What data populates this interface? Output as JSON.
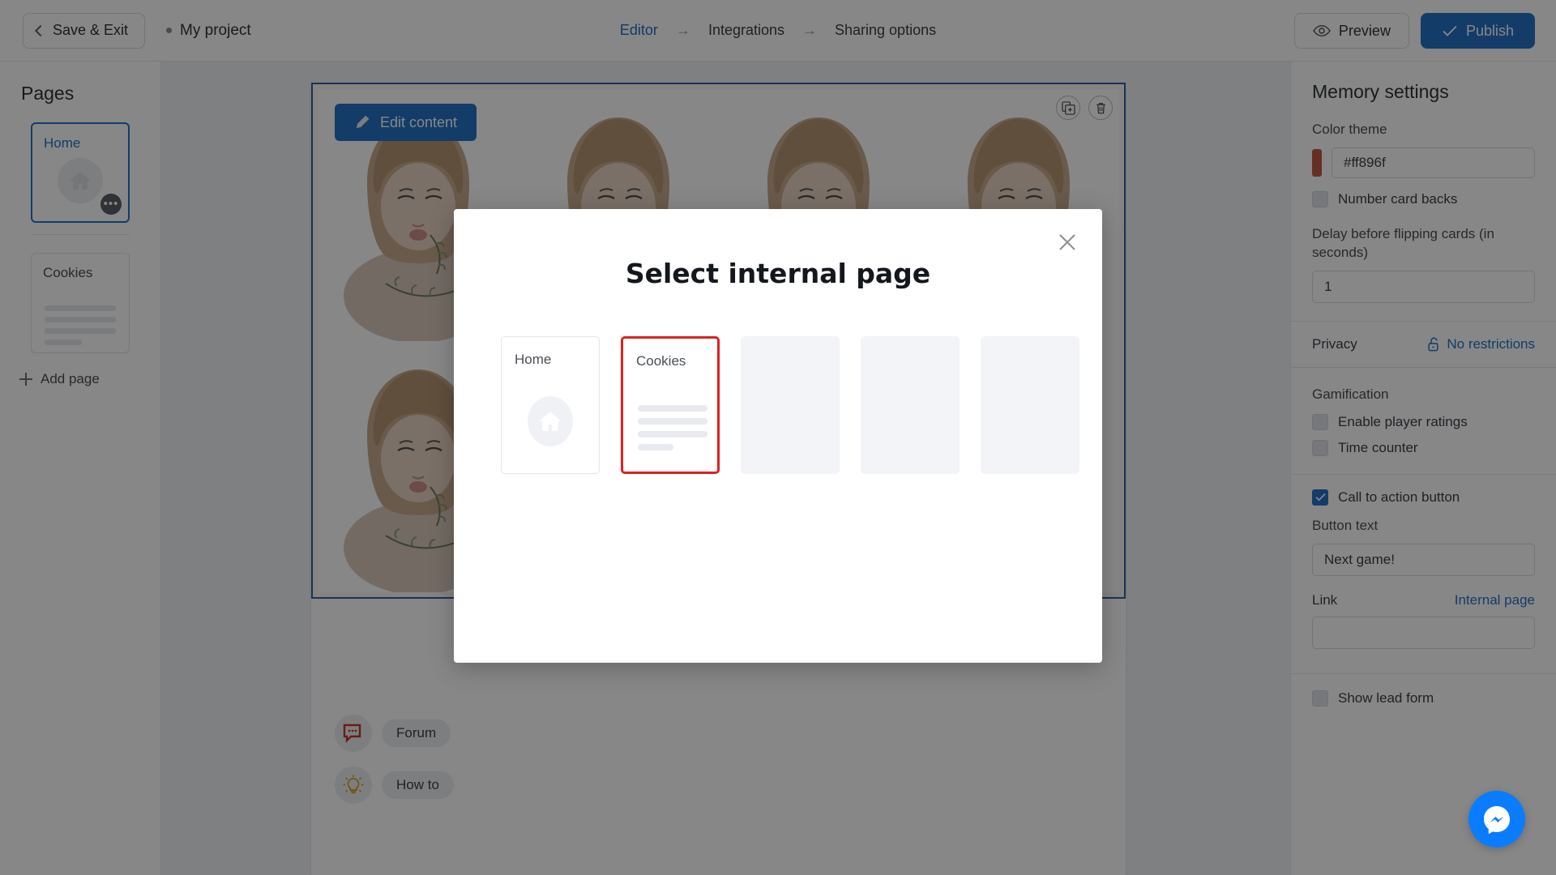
{
  "topbar": {
    "save_exit_label": "Save & Exit",
    "project_name": "My project",
    "breadcrumbs": [
      {
        "label": "Editor",
        "active": true
      },
      {
        "label": "Integrations",
        "active": false
      },
      {
        "label": "Sharing options",
        "active": false
      }
    ],
    "arrow_glyph": "→",
    "preview_label": "Preview",
    "publish_label": "Publish"
  },
  "sidebar": {
    "title": "Pages",
    "pages": [
      {
        "label": "Home",
        "selected": true,
        "thumb": "home-icon"
      },
      {
        "label": "Cookies",
        "selected": false,
        "thumb": "text-lines"
      }
    ],
    "add_page_label": "Add page"
  },
  "canvas": {
    "edit_content_label": "Edit content",
    "tools": [
      {
        "name": "duplicate-icon"
      },
      {
        "name": "delete-icon"
      }
    ],
    "cards_count": 8
  },
  "right_panel": {
    "title": "Memory settings",
    "color_theme_label": "Color theme",
    "color_theme_value": "#ff896f",
    "color_swatch_hex": "#c15a43",
    "number_card_backs_label": "Number card backs",
    "number_card_backs_checked": false,
    "delay_label": "Delay before flipping cards (in seconds)",
    "delay_value": "1",
    "privacy_label": "Privacy",
    "privacy_value": "No restrictions",
    "gamification_label": "Gamification",
    "enable_player_ratings_label": "Enable player ratings",
    "enable_player_ratings_checked": false,
    "time_counter_label": "Time counter",
    "time_counter_checked": false,
    "cta_label": "Call to action button",
    "cta_checked": true,
    "button_text_label": "Button text",
    "button_text_value": "Next game!",
    "link_label": "Link",
    "link_value": "Internal page",
    "link_field_value": "",
    "show_lead_form_label": "Show lead form",
    "show_lead_form_checked": false
  },
  "floaters": {
    "forum_label": "Forum",
    "howto_label": "How to",
    "messenger_name": "messenger-icon"
  },
  "modal": {
    "title": "Select internal page",
    "close_label": "✕",
    "pages": [
      {
        "label": "Home",
        "type": "home",
        "highlighted": false
      },
      {
        "label": "Cookies",
        "type": "lines",
        "highlighted": true
      },
      {
        "label": "",
        "type": "empty",
        "highlighted": false
      },
      {
        "label": "",
        "type": "empty",
        "highlighted": false
      },
      {
        "label": "",
        "type": "empty",
        "highlighted": false
      }
    ]
  },
  "colors": {
    "accent_blue": "#2571c6",
    "highlight_red": "#e02020",
    "messenger_blue": "#0a7cff",
    "panel_border": "#e6e8ec"
  }
}
